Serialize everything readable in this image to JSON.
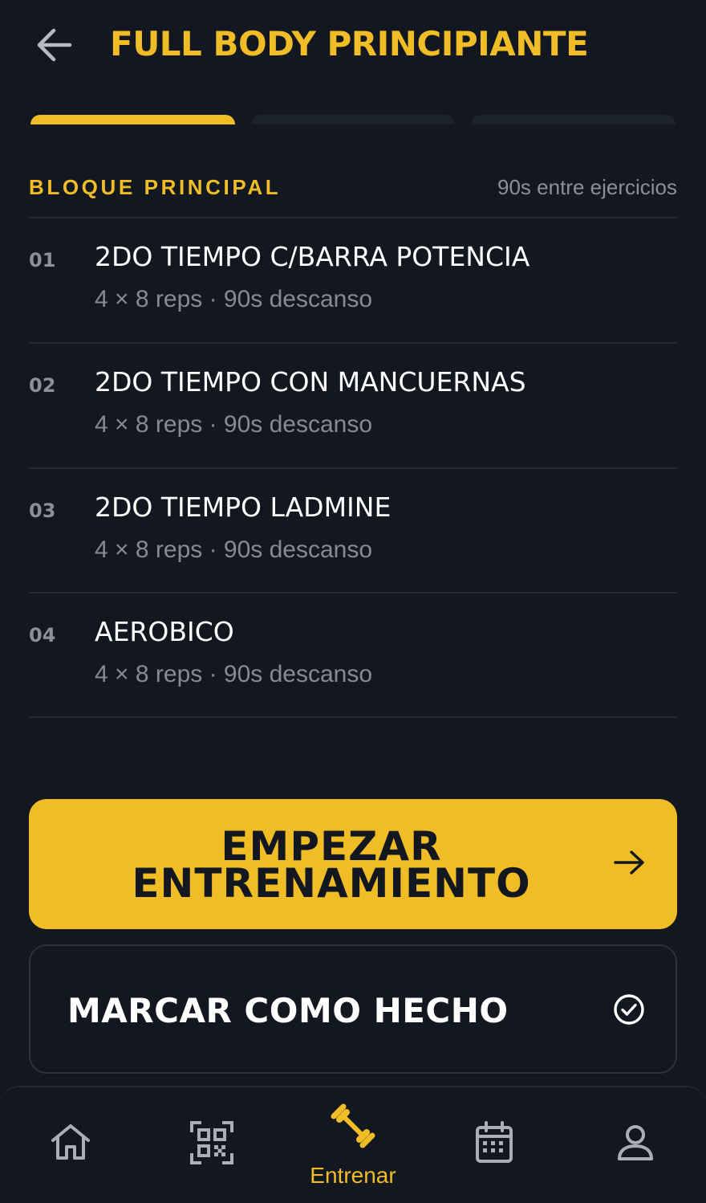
{
  "header": {
    "title": "FULL BODY PRINCIPIANTE"
  },
  "progress": {
    "segments": 3,
    "active_segment": 1
  },
  "section": {
    "title": "BLOQUE PRINCIPAL",
    "rest_info": "90s entre ejercicios"
  },
  "exercises": [
    {
      "number": "01",
      "name": "2DO TIEMPO C/BARRA POTENCIA",
      "meta": "4 × 8 reps · 90s descanso"
    },
    {
      "number": "02",
      "name": "2DO TIEMPO CON MANCUERNAS",
      "meta": "4 × 8 reps · 90s descanso"
    },
    {
      "number": "03",
      "name": "2DO TIEMPO LADMINE",
      "meta": "4 × 8 reps · 90s descanso"
    },
    {
      "number": "04",
      "name": "AEROBICO",
      "meta": "4 × 8 reps · 90s descanso"
    }
  ],
  "actions": {
    "start_line1": "EMPEZAR",
    "start_line2": "ENTRENAMIENTO",
    "mark_done": "MARCAR COMO HECHO"
  },
  "nav": {
    "items": [
      {
        "icon": "home-icon"
      },
      {
        "icon": "qr-code-icon"
      },
      {
        "icon": "dumbbell-icon",
        "label": "Entrenar",
        "active": true
      },
      {
        "icon": "calendar-icon"
      },
      {
        "icon": "profile-icon"
      }
    ]
  },
  "colors": {
    "background": "#121720",
    "accent": "#f0bd27",
    "muted_text": "#8a9099",
    "icon_gray": "#a9afb8"
  }
}
